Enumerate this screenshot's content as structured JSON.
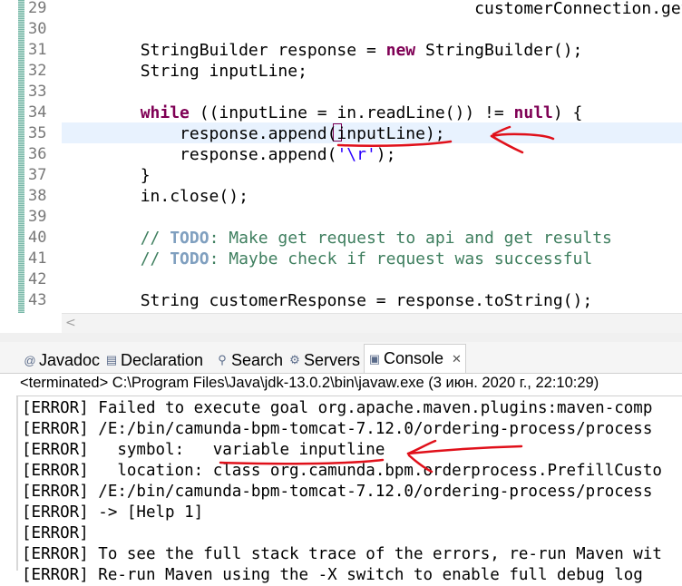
{
  "editor": {
    "lines": [
      {
        "no": "29",
        "code": "                                          customerConnection.get"
      },
      {
        "no": "30",
        "code": ""
      },
      {
        "no": "31",
        "code": "        StringBuilder response = new StringBuilder();"
      },
      {
        "no": "32",
        "code": "        String inputLine;"
      },
      {
        "no": "33",
        "code": ""
      },
      {
        "no": "34",
        "code": "        while ((inputLine = in.readLine()) != null) {"
      },
      {
        "no": "35",
        "code": "            response.append(inputLine);"
      },
      {
        "no": "36",
        "code": "            response.append('\\r');"
      },
      {
        "no": "37",
        "code": "        }"
      },
      {
        "no": "38",
        "code": "        in.close();"
      },
      {
        "no": "39",
        "code": ""
      },
      {
        "no": "40",
        "code": "        // TODO: Make get request to api and get results"
      },
      {
        "no": "41",
        "code": "        // TODO: Maybe check if request was successful"
      },
      {
        "no": "42",
        "code": ""
      },
      {
        "no": "43",
        "code": "        String customerResponse = response.toString();"
      }
    ]
  },
  "tabs": [
    {
      "label": "Javadoc",
      "icon": "at-icon",
      "glyph": "@"
    },
    {
      "label": "Declaration",
      "icon": "declaration-icon",
      "glyph": "▤"
    },
    {
      "label": "Search",
      "icon": "search-icon",
      "glyph": "⚲"
    },
    {
      "label": "Servers",
      "icon": "servers-icon",
      "glyph": "⚙"
    },
    {
      "label": "Console",
      "icon": "console-icon",
      "glyph": "▣",
      "active": true,
      "close": "✕"
    }
  ],
  "console": {
    "status": "<terminated> C:\\Program Files\\Java\\jdk-13.0.2\\bin\\javaw.exe (3 июн. 2020 г., 22:10:29)",
    "lines": [
      "[ERROR] Failed to execute goal org.apache.maven.plugins:maven-comp",
      "[ERROR] /E:/bin/camunda-bpm-tomcat-7.12.0/ordering-process/process",
      "[ERROR]   symbol:   variable inputline",
      "[ERROR]   location: class org.camunda.bpm.orderprocess.PrefillCusto",
      "[ERROR] /E:/bin/camunda-bpm-tomcat-7.12.0/ordering-process/process",
      "[ERROR] -> [Help 1]",
      "[ERROR]",
      "[ERROR] To see the full stack trace of the errors, re-run Maven wit",
      "[ERROR] Re-run Maven using the -X switch to enable full debug log"
    ]
  },
  "colors": {
    "keyword": "#7f0055",
    "comment": "#3f7f5f",
    "todo": "#7f9fbf",
    "string": "#2a00ff",
    "annotation": "#e0101a",
    "current_line": "#e8f2fe"
  }
}
